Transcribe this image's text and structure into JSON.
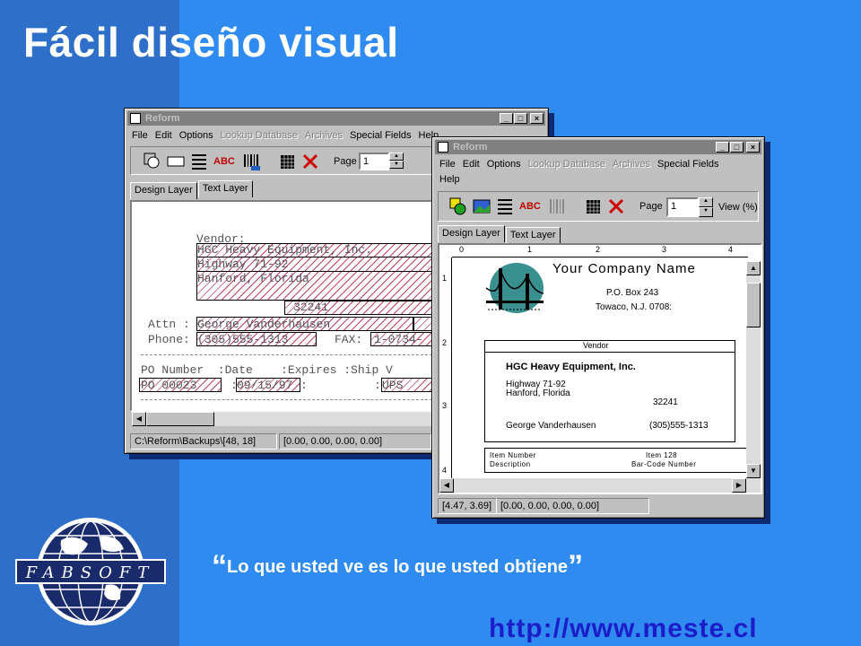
{
  "slide": {
    "title": "Fácil diseño visual",
    "tagline_open": "“",
    "tagline": "Lo que usted ve es lo que usted obtiene",
    "tagline_close": "”",
    "url": "http://www.meste.cl",
    "logo_text": "FABSOFT"
  },
  "back_window": {
    "title": "Reform",
    "menu": [
      "File",
      "Edit",
      "Options",
      "Lookup Database",
      "Archives",
      "Special Fields",
      "Help"
    ],
    "page_label": "Page",
    "page_value": "1",
    "tabs": [
      "Design Layer",
      "Text Layer"
    ],
    "active_tab": "Text Layer",
    "tool_abc": "ABC",
    "text_layer": {
      "vendor_label": "Vendor:",
      "vendor_name": "HGC Heavy Equipment, Inc.",
      "address1": "Highway 71-92",
      "address2": "Hanford, Florida",
      "zip": "32241",
      "attn_label": "Attn :",
      "attn_value": "George Vanderhausen",
      "phone_label": "Phone:",
      "phone_value": "(305)555-1313",
      "fax_label": "FAX:",
      "fax_value": "1-0734-",
      "po_header": "PO Number  :Date    :Expires :Ship V",
      "po_number": "PO 00023",
      "date_value": "09/15/97",
      "ship_value": "UPS",
      "sep1": ":",
      "sep2": ":",
      "sep3": ":"
    },
    "status": {
      "path": "C:\\Reform\\Backups\\[48, 18]",
      "coords": "[0.00, 0.00, 0.00, 0.00]"
    }
  },
  "front_window": {
    "title": "Reform",
    "menu": [
      "File",
      "Edit",
      "Options",
      "Lookup Database",
      "Archives",
      "Special Fields",
      "Help"
    ],
    "page_label": "Page",
    "page_value": "1",
    "view_label": "View (%)",
    "tabs": [
      "Design Layer",
      "Text Layer"
    ],
    "active_tab": "Design Layer",
    "tool_abc": "ABC",
    "ruler": [
      "0",
      "1",
      "2",
      "3",
      "4"
    ],
    "vruler": [
      "1",
      "2",
      "3",
      "4"
    ],
    "form": {
      "company": "Your Company Name",
      "po_box": "P.O. Box 243",
      "city": "Towaco, N.J. 0708:",
      "vendor_header": "Vendor",
      "vendor_name": "HGC Heavy Equipment, Inc.",
      "address1": "Highway 71-92",
      "address2": "Hanford, Florida",
      "zip": "32241",
      "contact": "George Vanderhausen",
      "phone": "(305)555-1313",
      "item_number_label": "Item Number",
      "description_label": "Description",
      "item_value": "Item 128",
      "barcode_label": "Bar-Code Number"
    },
    "status": {
      "coords1": "[4.47, 3.69]",
      "coords2": "[0.00, 0.00, 0.00, 0.00]"
    }
  }
}
